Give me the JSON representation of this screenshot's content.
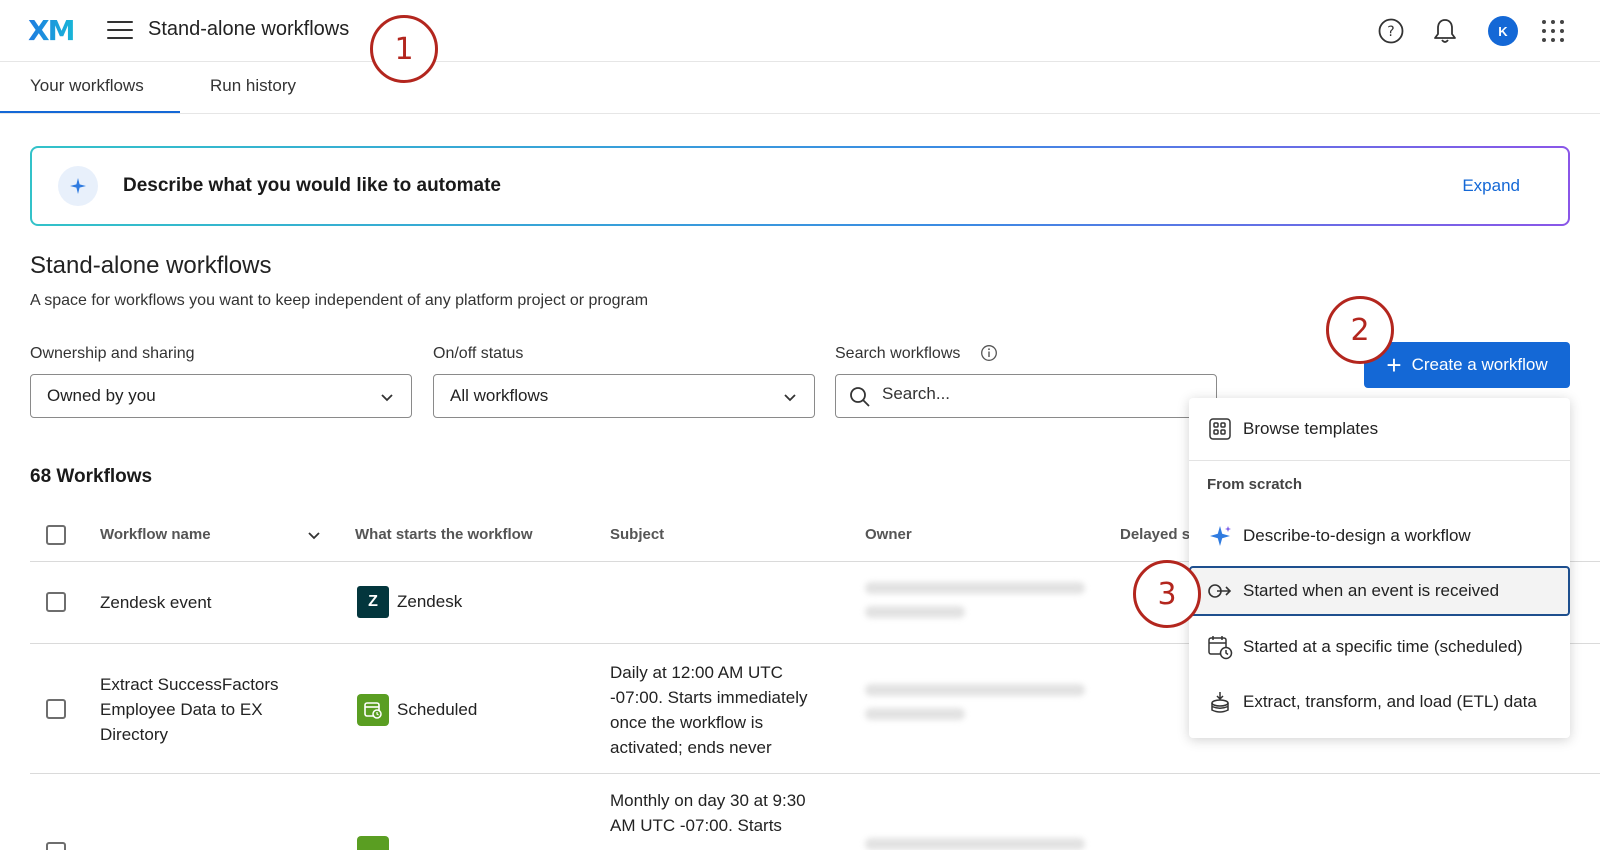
{
  "header": {
    "logo": "XM",
    "title": "Stand-alone workflows",
    "avatar_initial": "K"
  },
  "tabs": [
    {
      "label": "Your workflows",
      "active": true
    },
    {
      "label": "Run history",
      "active": false
    }
  ],
  "annotations": [
    "1",
    "2",
    "3"
  ],
  "banner": {
    "text": "Describe what you would like to automate",
    "action": "Expand"
  },
  "section": {
    "title": "Stand-alone workflows",
    "subtitle": "A space for workflows you want to keep independent of any platform project or program"
  },
  "filters": {
    "ownership": {
      "label": "Ownership and sharing",
      "value": "Owned by you"
    },
    "status": {
      "label": "On/off status",
      "value": "All workflows"
    },
    "search": {
      "label": "Search workflows",
      "placeholder": "Search..."
    }
  },
  "create_button": "Create a workflow",
  "count_label": "68 Workflows",
  "table": {
    "columns": [
      "Workflow name",
      "What starts the workflow",
      "Subject",
      "Owner",
      "Delayed s"
    ],
    "rows": [
      {
        "name": "Zendesk event",
        "trigger": "Zendesk",
        "trigger_icon": "zendesk-icon",
        "subject": ""
      },
      {
        "name": "Extract SuccessFactors Employee Data to EX Directory",
        "trigger": "Scheduled",
        "trigger_icon": "scheduled-icon",
        "subject": "Daily at 12:00 AM UTC -07:00. Starts immediately once the workflow is activated; ends never"
      },
      {
        "name": "",
        "trigger": "",
        "trigger_icon": "scheduled-icon",
        "subject": "Monthly on day 30 at 9:30 AM UTC -07:00. Starts"
      }
    ]
  },
  "menu": {
    "browse": "Browse templates",
    "group_label": "From scratch",
    "items": [
      {
        "label": "Describe-to-design a workflow",
        "icon": "sparkle-icon"
      },
      {
        "label": "Started when an event is received",
        "icon": "event-arrow-icon",
        "highlighted": true
      },
      {
        "label": "Started at a specific time (scheduled)",
        "icon": "calendar-clock-icon"
      },
      {
        "label": "Extract, transform, and load (ETL) data",
        "icon": "database-icon"
      }
    ]
  },
  "colors": {
    "primary": "#1468d6",
    "annotation": "#b3261e",
    "zendesk": "#03363d",
    "scheduled": "#5a9e22"
  }
}
